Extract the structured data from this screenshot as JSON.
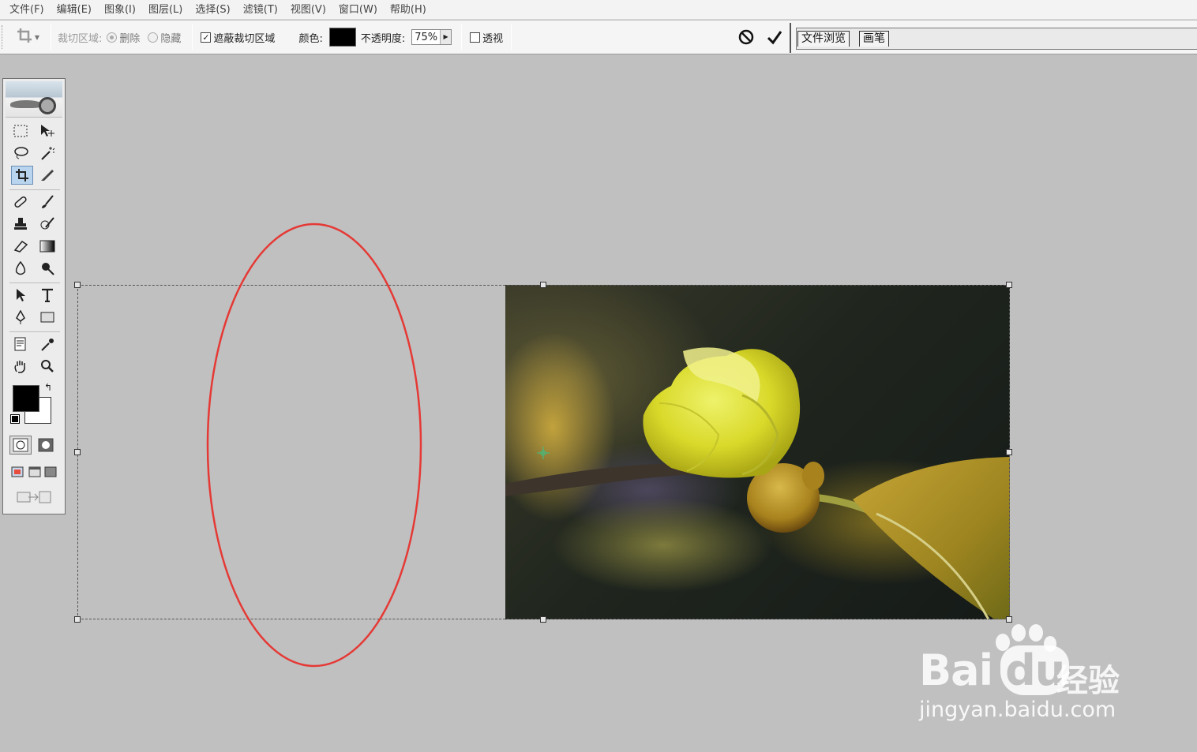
{
  "menu": [
    "文件(F)",
    "编辑(E)",
    "图象(I)",
    "图层(L)",
    "选择(S)",
    "滤镜(T)",
    "视图(V)",
    "窗口(W)",
    "帮助(H)"
  ],
  "options": {
    "crop_area_label": "裁切区域:",
    "delete_label": "删除",
    "hide_label": "隐藏",
    "shield_label": "遮蔽裁切区域",
    "shield_checked": true,
    "color_label": "颜色:",
    "shield_color": "#000000",
    "opacity_label": "不透明度:",
    "opacity_value": "75%",
    "perspective_label": "透视",
    "perspective_checked": false
  },
  "palette_well": {
    "tabs": [
      "文件浏览",
      "画笔"
    ]
  },
  "toolbox": {
    "tools": [
      "rectangular-marquee-tool",
      "move-tool",
      "lasso-tool",
      "magic-wand-tool",
      "crop-tool",
      "slice-tool",
      "healing-brush-tool",
      "brush-tool",
      "clone-stamp-tool",
      "history-brush-tool",
      "eraser-tool",
      "gradient-tool",
      "blur-tool",
      "dodge-tool",
      "path-selection-tool",
      "type-tool",
      "pen-tool",
      "rectangle-tool",
      "notes-tool",
      "eyedropper-tool",
      "hand-tool",
      "zoom-tool"
    ],
    "active_tool": "crop-tool",
    "foreground_color": "#000000",
    "background_color": "#ffffff"
  },
  "annotation": {
    "color": "#e53935"
  },
  "watermark": {
    "logo": "Bai",
    "logo_du": "du",
    "logo_cn": "经验",
    "url": "jingyan.baidu.com"
  }
}
